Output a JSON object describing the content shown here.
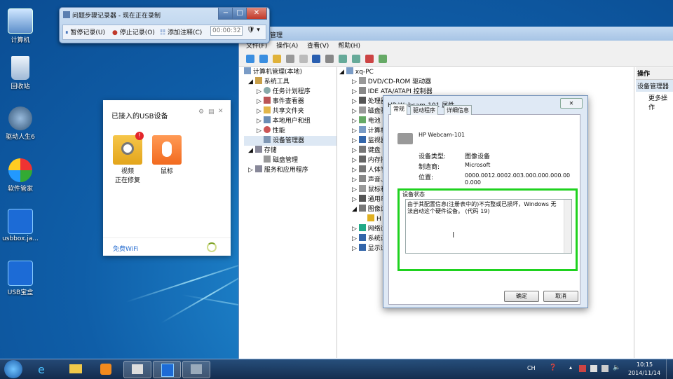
{
  "desktop": {
    "icons": [
      {
        "label": "计算机",
        "icon": "computer-icon"
      },
      {
        "label": "回收站",
        "icon": "recycle-bin-icon"
      },
      {
        "label": "驱动人生6",
        "icon": "driver-icon"
      },
      {
        "label": "软件管家",
        "icon": "software-manager-icon"
      },
      {
        "label": "usbbox.ja...",
        "icon": "usb-icon"
      },
      {
        "label": "USB宝盒",
        "icon": "usb-box-icon"
      }
    ]
  },
  "steps_recorder": {
    "title": "问题步骤记录器 - 现在正在录制",
    "pause": "暂停记录(U)",
    "stop": "停止记录(O)",
    "comment": "添加注释(C)",
    "timer": "00:00:32"
  },
  "comp_mgmt": {
    "title_partial": "管理",
    "menu": [
      "文件(F)",
      "操作(A)",
      "查看(V)",
      "帮助(H)"
    ],
    "tree": [
      {
        "label": "计算机管理(本地)"
      },
      {
        "label": "系统工具"
      },
      {
        "label": "任务计划程序"
      },
      {
        "label": "事件查看器"
      },
      {
        "label": "共享文件夹"
      },
      {
        "label": "本地用户和组"
      },
      {
        "label": "性能"
      },
      {
        "label": "设备管理器"
      },
      {
        "label": "存储"
      },
      {
        "label": "磁盘管理"
      },
      {
        "label": "服务和应用程序"
      }
    ],
    "devices": [
      {
        "label": "xq-PC"
      },
      {
        "label": "DVD/CD-ROM 驱动器"
      },
      {
        "label": "IDE ATA/ATAPI 控制器"
      },
      {
        "label": "处理器"
      },
      {
        "label": "磁盘驱"
      },
      {
        "label": "电池"
      },
      {
        "label": "计算机"
      },
      {
        "label": "监视器"
      },
      {
        "label": "键盘"
      },
      {
        "label": "内存技"
      },
      {
        "label": "人体学"
      },
      {
        "label": "声音、"
      },
      {
        "label": "鼠标和"
      },
      {
        "label": "通用串"
      },
      {
        "label": "图像设"
      },
      {
        "label": "H"
      },
      {
        "label": "网络适"
      },
      {
        "label": "系统设"
      },
      {
        "label": "显示适"
      }
    ],
    "actions_header": "操作",
    "actions_sub": "设备管理器",
    "actions_more": "更多操作"
  },
  "usb_panel": {
    "title": "已接入的USB设备",
    "dev1_name": "视频",
    "dev1_status": "正在修复",
    "dev2_name": "鼠标",
    "footer": "免费WiFi"
  },
  "dialog": {
    "title": "HP Webcam-101 属性",
    "tabs": [
      "常规",
      "驱动程序",
      "详细信息"
    ],
    "device_name": "HP Webcam-101",
    "type_label": "设备类型:",
    "type_value": "图像设备",
    "mfr_label": "制造商:",
    "mfr_value": "Microsoft",
    "loc_label": "位置:",
    "loc_value": "0000.0012.0002.003.000.000.000.000.000",
    "status_label": "设备状态",
    "status_text": "由于其配置信息(注册表中的)不完整或已损坏，Windows 无法启动这个硬件设备。 (代码 19)",
    "ok": "确定",
    "cancel": "取消",
    "highlight_color": "#1fd21f"
  },
  "taskbar": {
    "time": "10:15",
    "date": "2014/11/14",
    "lang": "CH"
  }
}
